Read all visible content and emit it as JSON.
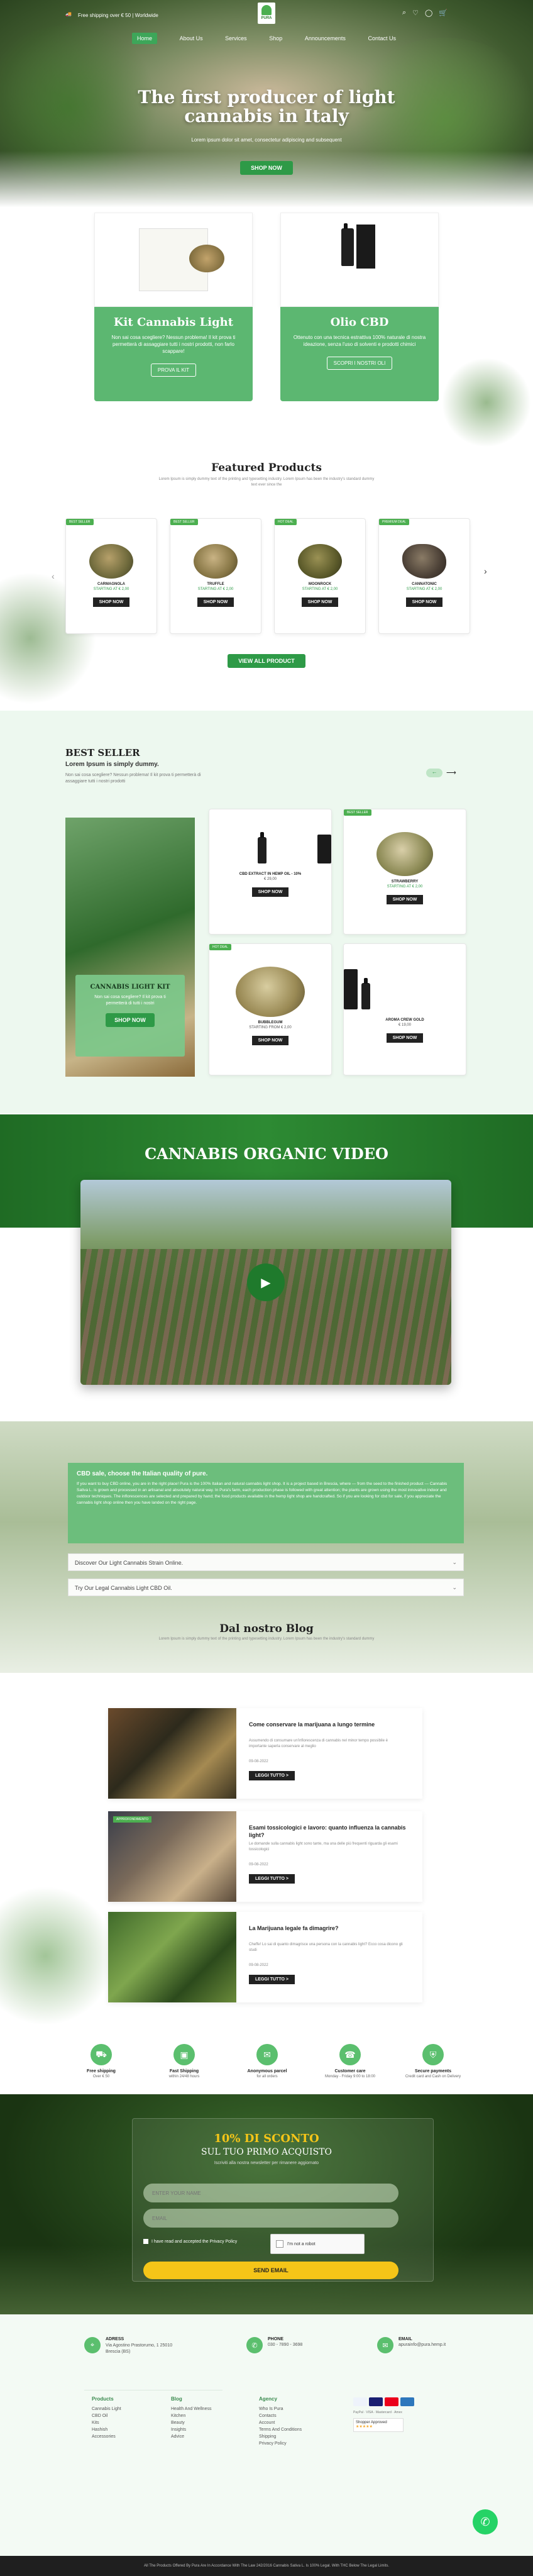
{
  "topbar": {
    "shipping": "Free shipping over € 50 | Worldwide"
  },
  "brand": {
    "logo": "PURA"
  },
  "nav": [
    "Home",
    "About Us",
    "Services",
    "Shop",
    "Announcements",
    "Contact Us"
  ],
  "hero": {
    "title": "The first producer of light cannabis in Italy",
    "subtitle": "Lorem ipsum dolor sit amet, consectetur adipiscing and subsequent",
    "cta": "SHOP NOW"
  },
  "promo": [
    {
      "title": "Kit Cannabis Light",
      "text": "Non sai cosa scegliere? Nessun problema! Il kit prova ti permetterà di assaggiare tutti i nostri prodotti, non farlo scappare!",
      "cta": "PROVA IL KIT"
    },
    {
      "title": "Olio CBD",
      "text": "Ottenuto con una tecnica estrattiva 100% naturale di nostra ideazione, senza l'uso di solventi e prodotti chimici",
      "cta": "SCOPRI I NOSTRI OLI"
    }
  ],
  "featured": {
    "title": "Featured Products",
    "subtitle": "Lorem Ipsum is simply dummy text of the printing and typesetting industry. Lorem Ipsum has been the industry's standard dummy text ever since the",
    "products": [
      {
        "badge": "BEST SELLER",
        "name": "CARMAGNOLA",
        "price": "STARTING AT € 2,00",
        "cta": "SHOP NOW"
      },
      {
        "badge": "BEST SELLER",
        "name": "TRUFFLE",
        "price": "STARTING AT € 2,00",
        "cta": "SHOP NOW"
      },
      {
        "badge": "HOT DEAL",
        "name": "MOONROCK",
        "price": "STARTING AT € 2,00",
        "cta": "SHOP NOW"
      },
      {
        "badge": "PREMIUM DEAL",
        "name": "CANNATONIC",
        "price": "STARTING AT € 2,00",
        "cta": "SHOP NOW"
      }
    ],
    "view_all": "VIEW ALL PRODUCT"
  },
  "bestseller": {
    "title": "BEST SELLER",
    "subtitle": "Lorem Ipsum is simply dummy.",
    "text": "Non sai cosa scegliere? Nessun problema! Il kit prova ti permetterà di assaggiare tutti i nostri prodotti",
    "kit": {
      "title": "CANNABIS LIGHT KIT",
      "text": "Non sai cosa scegliere? Il kit prova ti permetterà di tutti i nostri",
      "cta": "SHOP NOW"
    },
    "products": [
      {
        "name": "CBD EXTRACT IN HEMP OIL - 10%",
        "price": "€ 29,00",
        "cta": "SHOP NOW"
      },
      {
        "badge": "BEST SELLER",
        "name": "STRAWBERRY",
        "price": "STARTING AT € 2,00",
        "cta": "SHOP NOW"
      },
      {
        "badge": "HOT DEAL",
        "name": "BUBBLEGUM",
        "price": "STARTING FROM € 2,00",
        "cta": "SHOP NOW"
      },
      {
        "name": "AROMA CREW GOLD",
        "price": "€ 19,00",
        "cta": "SHOP NOW"
      }
    ]
  },
  "video": {
    "title": "CANNABIS ORGANIC VIDEO"
  },
  "seo": {
    "title": "CBD sale, choose the Italian quality of pure.",
    "text": "If you want to buy CBD online, you are in the right place! Pura is the 100% Italian and natural cannabis light shop. It is a project based in Brescia, where — from the seed to the finished product — Cannabis Sativa L. is grown and processed in an artisanal and absolutely natural way. In Pura's farm, each production phase is followed with great attention; the plants are grown using the most innovative indoor and outdoor techniques. The inflorescences are selected and prepared by hand; the food products available in the hemp light shop are handcrafted. So if you are looking for cbd for sale, if you appreciate the cannabis light shop online then you have landed on the right page.",
    "accordion": [
      "Discover Our Light Cannabis Strain Online.",
      "Try Our Legal Cannabis Light CBD Oil."
    ]
  },
  "blog": {
    "title": "Dal nostro Blog",
    "subtitle": "Lorem Ipsum is simply dummy text of the printing and typesetting industry. Lorem Ipsum has been the industry's standard dummy",
    "posts": [
      {
        "title": "Come conservare la marijuana a lungo termine",
        "text": "Assumendo di consumare un'infiorescenza di cannabis nel minor tempo possibile è importante saperla conservare al meglio",
        "date": "09-08-2022",
        "cta": "LEGGI TUTTO >"
      },
      {
        "tag": "APPROFONDIMENTO",
        "title": "Esami tossicologici e lavoro: quanto influenza la cannabis light?",
        "text": "Le domande sulla cannabis light sono tante, ma una delle più frequenti riguarda gli esami tossicologici",
        "date": "09-08-2022",
        "cta": "LEGGI TUTTO >"
      },
      {
        "title": "La Marijuana legale fa dimagrire?",
        "text": "Cheffe! Lo sai di quanto dimagrisce una persona con la cannabis light? Ecco cosa dicono gli studi",
        "date": "09-08-2022",
        "cta": "LEGGI TUTTO >"
      }
    ]
  },
  "features": [
    {
      "title": "Free shipping",
      "sub": "Over € 50"
    },
    {
      "title": "Fast Shipping",
      "sub": "within 24/48 hours"
    },
    {
      "title": "Anonymous parcel",
      "sub": "for all orders"
    },
    {
      "title": "Customer care",
      "sub": "Monday - Friday 9:00 to 18:00"
    },
    {
      "title": "Secure payments",
      "sub": "Credit card and Cash on Delivery"
    }
  ],
  "newsletter": {
    "discount": "10% DI SCONTO",
    "title": "SUL TUO PRIMO ACQUISTO",
    "subtitle": "Iscriviti alla nostra newsletter per rimanere aggiornato",
    "name_placeholder": "ENTER YOUR NAME",
    "email_placeholder": "EMAIL",
    "privacy": "I have read and accepted the Privacy Policy",
    "recaptcha": "I'm not a robot",
    "cta": "SEND EMAIL"
  },
  "contact": [
    {
      "label": "ADRESS",
      "value": "Via Agostino Prastorumo, 1 25010 Brescia (BS)"
    },
    {
      "label": "PHONE",
      "value": "030 - 7890 - 3698"
    },
    {
      "label": "EMAIL",
      "value": "apurainfo@pura.hemp.it"
    }
  ],
  "footer_cols": [
    {
      "heading": "Products",
      "items": [
        "Cannabis Light",
        "CBD Oil",
        "Kits",
        "Hashish",
        "Accessories"
      ]
    },
    {
      "heading": "Blog",
      "items": [
        "Health And Wellness",
        "Kitchen",
        "Beauty",
        "Insights",
        "Advice"
      ]
    },
    {
      "heading": "Agency",
      "items": [
        "Who Is Pura",
        "Contacts",
        "Account",
        "Terms And Conditions",
        "Shipping",
        "Privacy Policy"
      ]
    }
  ],
  "payments": [
    "PayPal",
    "VISA",
    "Mastercard",
    "Amex"
  ],
  "shopper": "Shopper Approved",
  "copyright": "All The Products Offered By Pura Are In Accordance With The Law 242/2016 Cannabis Sativa L. Is 100% Legal. With THC Below The Legal Limits."
}
